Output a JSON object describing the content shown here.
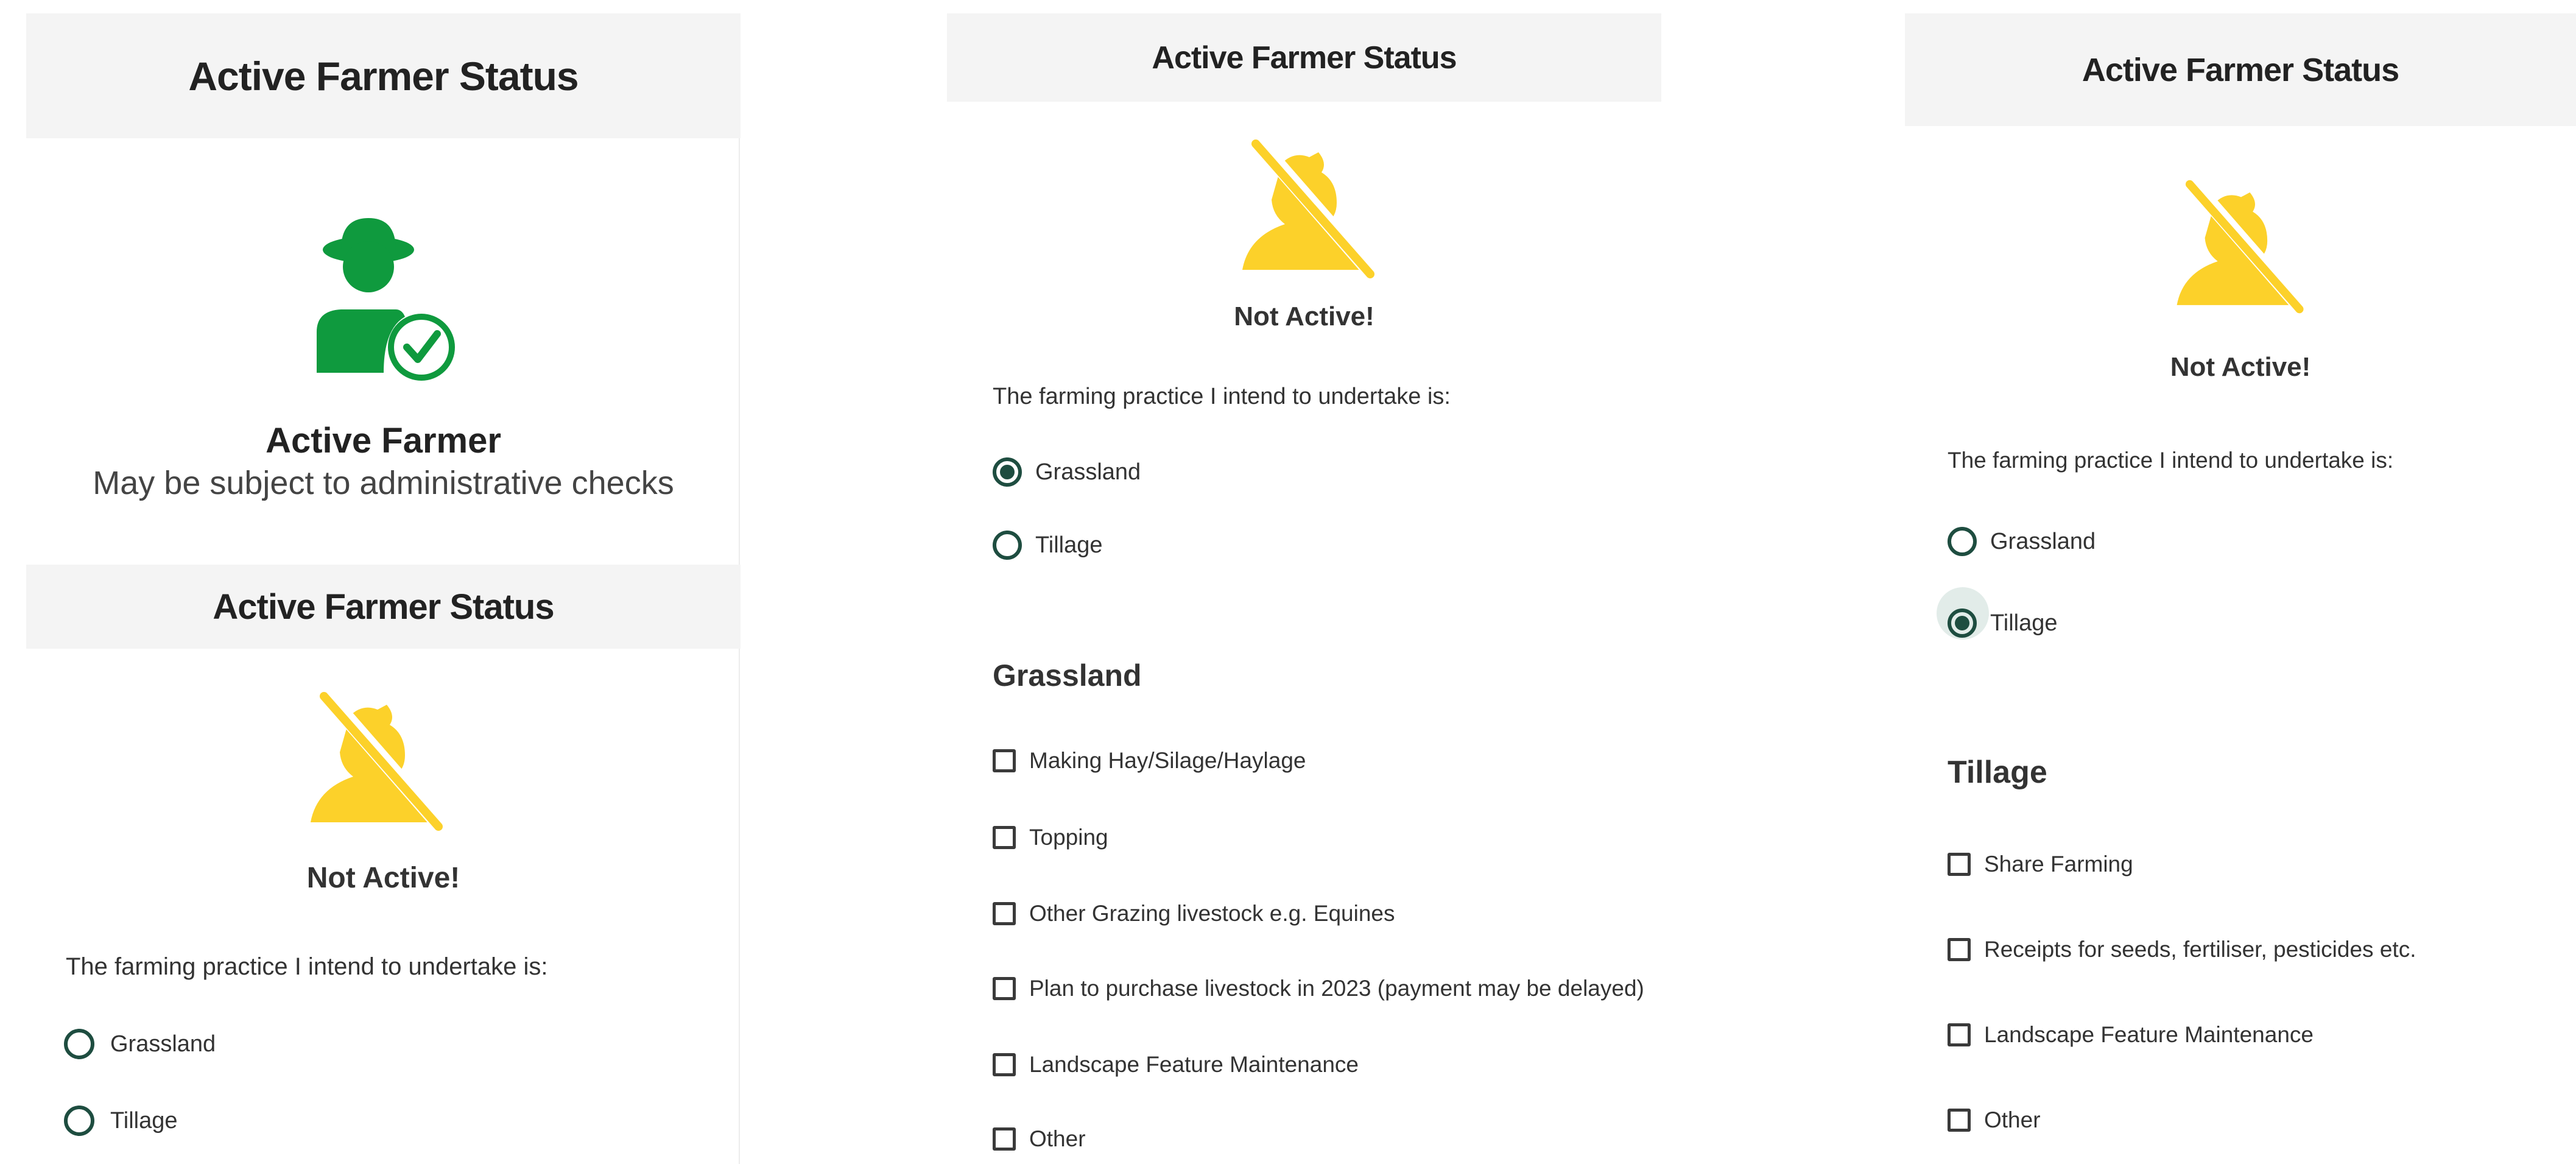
{
  "colors": {
    "active_green": "#0f9a3e",
    "inactive_yellow": "#fcd12a",
    "radio_green": "#1e4d40",
    "header_bg": "#f4f4f4"
  },
  "panel_a": {
    "header": "Active Farmer Status",
    "icon": "active-farmer-check-icon",
    "status_title": "Active Farmer",
    "status_subtitle": "May be subject to administrative checks"
  },
  "panel_b": {
    "header": "Active Farmer Status",
    "icon": "not-active-farmer-icon",
    "status": "Not Active!",
    "question": "The farming practice I intend to undertake is:",
    "options": [
      {
        "label": "Grassland",
        "selected": false
      },
      {
        "label": "Tillage",
        "selected": false
      }
    ]
  },
  "panel_c": {
    "header": "Active Farmer Status",
    "icon": "not-active-farmer-icon",
    "status": "Not Active!",
    "question": "The farming practice I intend to undertake is:",
    "options": [
      {
        "label": "Grassland",
        "selected": true
      },
      {
        "label": "Tillage",
        "selected": false
      }
    ],
    "section_title": "Grassland",
    "checkboxes": [
      "Making Hay/Silage/Haylage",
      "Topping",
      "Other Grazing livestock e.g. Equines",
      "Plan to purchase livestock in 2023 (payment may be delayed)",
      "Landscape Feature Maintenance",
      "Other"
    ]
  },
  "panel_d": {
    "header": "Active Farmer Status",
    "icon": "not-active-farmer-icon",
    "status": "Not Active!",
    "question": "The farming practice I intend to undertake is:",
    "options": [
      {
        "label": "Grassland",
        "selected": false
      },
      {
        "label": "Tillage",
        "selected": true
      }
    ],
    "section_title": "Tillage",
    "checkboxes": [
      "Share Farming",
      "Receipts for seeds, fertiliser, pesticides etc.",
      "Landscape Feature Maintenance",
      "Other"
    ]
  }
}
